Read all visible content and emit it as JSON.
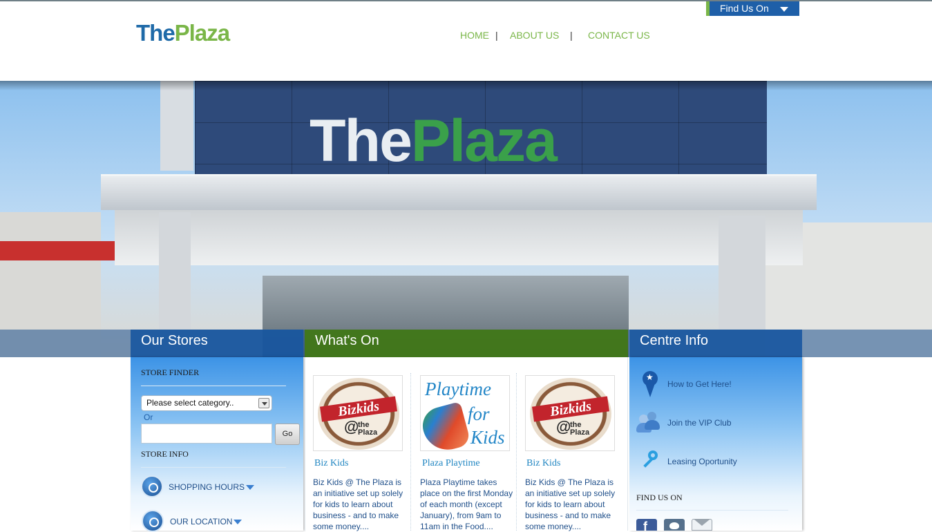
{
  "header": {
    "find_us_label": "Find Us On",
    "logo": {
      "the": "The",
      "plaza": "Plaza"
    },
    "nav": [
      {
        "label": "HOME"
      },
      {
        "label": "ABOUT US"
      },
      {
        "label": "CONTACT US"
      }
    ],
    "nav_separator": "|"
  },
  "hero": {
    "sign_the": "The",
    "sign_plaza": "Plaza"
  },
  "tabs": {
    "our_stores": "Our Stores",
    "whats_on": "What's On",
    "centre_info": "Centre Info"
  },
  "our_stores": {
    "store_finder_heading": "STORE FINDER",
    "category_select": "Please select category..",
    "or_label": "Or",
    "search_value": "",
    "go_label": "Go",
    "store_info_heading": "STORE INFO",
    "info_links": [
      {
        "label": "SHOPPING HOURS"
      },
      {
        "label": "OUR LOCATION"
      }
    ]
  },
  "whats_on": {
    "cards": [
      {
        "image_text": {
          "band": "Bizkids",
          "at": "@",
          "sub1": "the",
          "sub2": "Plaza"
        },
        "title": "Biz Kids",
        "text": "Biz Kids @ The Plaza is an initiative set up solely for kids to learn about business - and to make some money...."
      },
      {
        "image_text": {
          "line1": "Playtime",
          "line2": "for",
          "line3": "Kids"
        },
        "title": "Plaza Playtime",
        "text": "Plaza Playtime takes place on the first Monday of each month (except January), from 9am to 11am in the Food...."
      },
      {
        "image_text": {
          "band": "Bizkids",
          "at": "@",
          "sub1": "the",
          "sub2": "Plaza"
        },
        "title": "Biz Kids",
        "text": "Biz Kids @ The Plaza is an initiative set up solely for kids to learn about business - and to make some money...."
      }
    ]
  },
  "centre_info": {
    "links": [
      {
        "label": "How to Get Here!",
        "icon": "map-pin-icon"
      },
      {
        "label": "Join the VIP Club",
        "icon": "users-icon"
      },
      {
        "label": "Leasing Oportunity",
        "icon": "key-icon"
      }
    ],
    "find_us_heading": "FIND US ON",
    "social": [
      {
        "icon": "facebook-icon",
        "glyph": "f"
      },
      {
        "icon": "twitter-icon"
      },
      {
        "icon": "email-icon"
      }
    ]
  },
  "colors": {
    "brand_blue": "#1f6aa8",
    "brand_green": "#7ab648",
    "whats_on_green": "#427814",
    "panel_blue": "#1856a0"
  }
}
